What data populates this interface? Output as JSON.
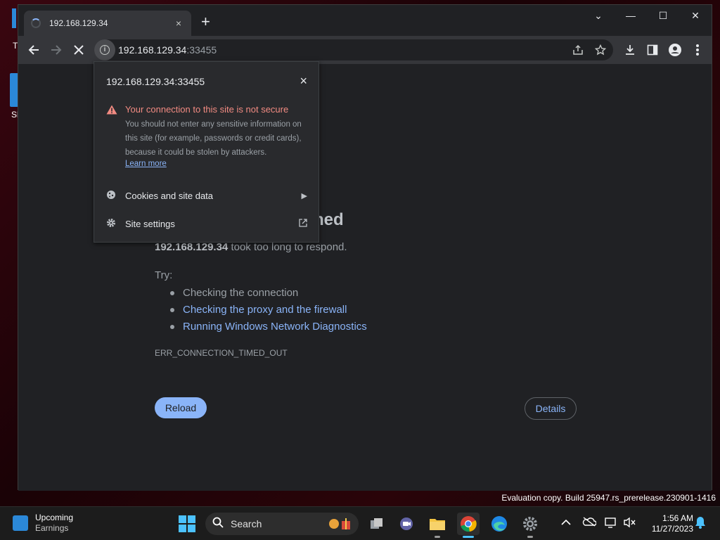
{
  "browser": {
    "tab_title": "192.168.129.34",
    "tab_close": "×",
    "new_tab": "+",
    "window_controls": {
      "tab_search": "⌄",
      "minimize": "—",
      "maximize": "☐",
      "close": "✕"
    },
    "omnibox": {
      "host": "192.168.129.34",
      "port": ":33455"
    },
    "toolbar_icons": [
      "back-icon",
      "forward-icon",
      "stop-icon",
      "site-info-icon",
      "share-icon",
      "bookmark-star-icon",
      "download-icon",
      "side-panel-icon",
      "profile-icon",
      "menu-icon"
    ]
  },
  "popup": {
    "host": "192.168.129.34:33455",
    "close": "×",
    "warning_title": "Your connection to this site is not secure",
    "warning_body": "You should not enter any sensitive information on this site (for example, passwords or credit cards), because it could be stolen by attackers.",
    "learn_more": "Learn more",
    "cookies_label": "Cookies and site data",
    "site_settings_label": "Site settings"
  },
  "page": {
    "title_visible": "hed",
    "host_bold": "192.168.129.34",
    "description_rest": " took too long to respond.",
    "try_label": "Try:",
    "suggestions": [
      "Checking the connection",
      "Checking the proxy and the firewall",
      "Running Windows Network Diagnostics"
    ],
    "error_code": "ERR_CONNECTION_TIMED_OUT",
    "reload_label": "Reload",
    "details_label": "Details"
  },
  "desktop": {
    "peek_text_t": "T",
    "peek_icon_label": "Sl",
    "watermark": "Evaluation copy. Build 25947.rs_prerelease.230901-1416"
  },
  "taskbar": {
    "widget_line1": "Upcoming",
    "widget_line2": "Earnings",
    "search_label": "Search",
    "time": "1:56 AM",
    "date": "11/27/2023",
    "apps": [
      "task-view-icon",
      "chat-icon",
      "file-explorer-icon",
      "chrome-icon",
      "edge-icon",
      "settings-icon"
    ]
  }
}
